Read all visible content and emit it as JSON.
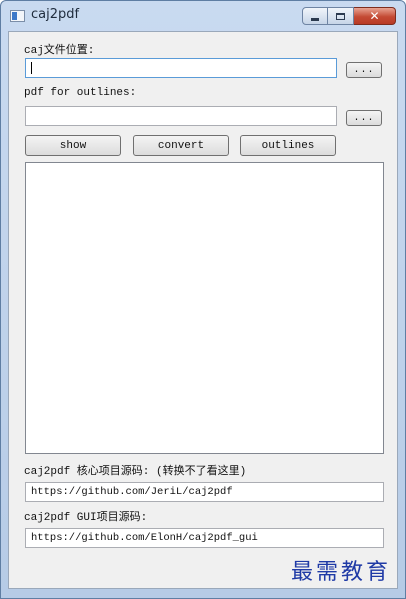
{
  "window": {
    "title": "caj2pdf"
  },
  "caj_file": {
    "label": "caj文件位置:",
    "value": "",
    "browse_label": "..."
  },
  "pdf_outlines": {
    "label": "pdf for outlines:",
    "value": "",
    "browse_label": "..."
  },
  "actions": {
    "show": "show",
    "convert": "convert",
    "outlines": "outlines"
  },
  "links": {
    "core_label": "caj2pdf 核心项目源码: (转换不了看这里)",
    "core_url": "https://github.com/JeriL/caj2pdf",
    "gui_label": "caj2pdf GUI项目源码:",
    "gui_url": "https://github.com/ElonH/caj2pdf_gui"
  },
  "watermark": "最需教育"
}
